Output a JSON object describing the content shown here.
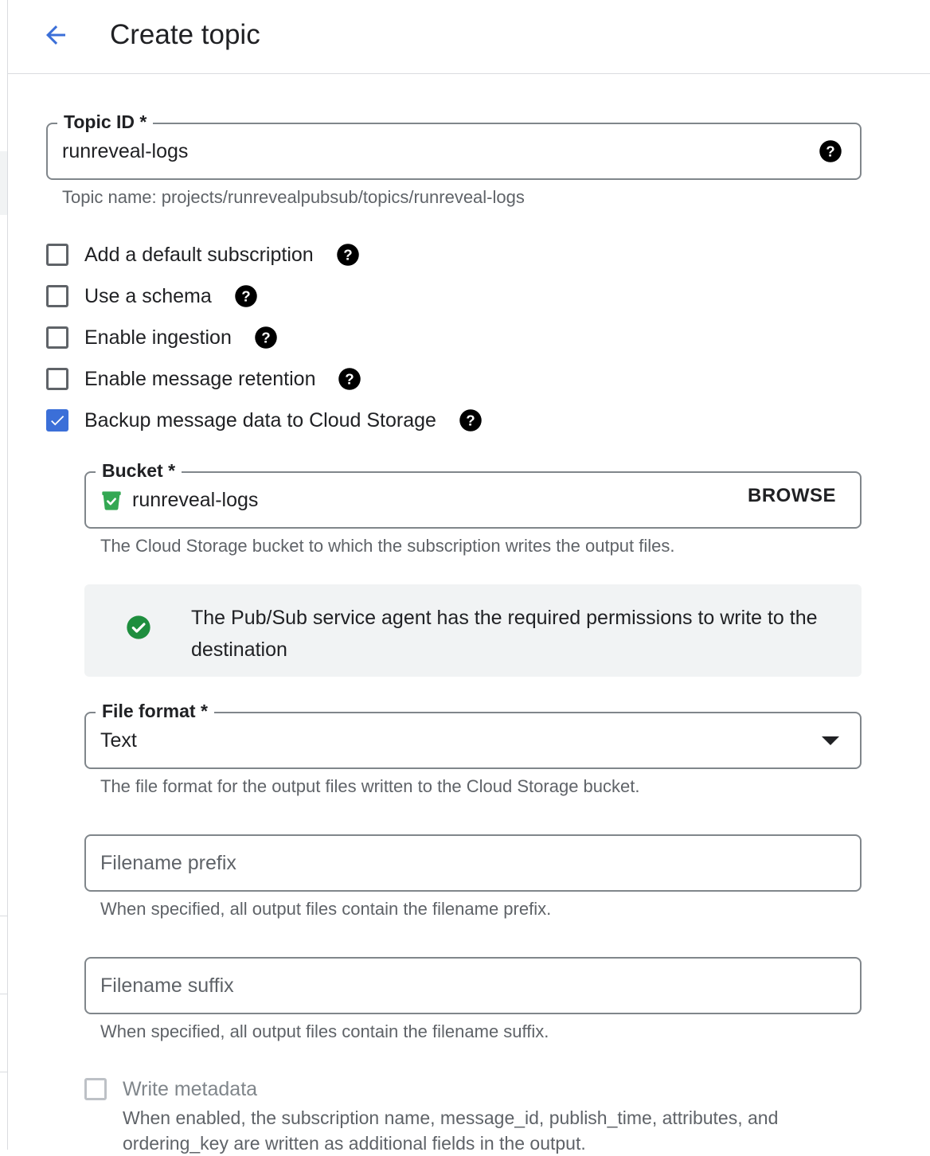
{
  "header": {
    "title": "Create topic"
  },
  "topic": {
    "label": "Topic ID *",
    "value": "runreveal-logs",
    "helper": "Topic name: projects/runrevealpubsub/topics/runreveal-logs"
  },
  "options": [
    {
      "label": "Add a default subscription",
      "checked": false
    },
    {
      "label": "Use a schema",
      "checked": false
    },
    {
      "label": "Enable ingestion",
      "checked": false
    },
    {
      "label": "Enable message retention",
      "checked": false
    },
    {
      "label": "Backup message data to Cloud Storage",
      "checked": true
    }
  ],
  "bucket": {
    "label": "Bucket *",
    "value": "runreveal-logs",
    "browse_label": "BROWSE",
    "helper": "The Cloud Storage bucket to which the subscription writes the output files."
  },
  "permission_notice": {
    "text": "The Pub/Sub service agent has the required permissions to write to the destination"
  },
  "file_format": {
    "label": "File format *",
    "value": "Text",
    "helper": "The file format for the output files written to the Cloud Storage bucket."
  },
  "filename_prefix": {
    "placeholder": "Filename prefix",
    "helper": "When specified, all output files contain the filename prefix."
  },
  "filename_suffix": {
    "placeholder": "Filename suffix",
    "helper": "When specified, all output files contain the filename suffix."
  },
  "write_metadata": {
    "label": "Write metadata",
    "checked": false,
    "disabled": true,
    "description": "When enabled, the subscription name, message_id, publish_time, attributes, and ordering_key are written as additional fields in the output."
  },
  "colors": {
    "accent": "#3b6fd8",
    "success": "#1e8e3e",
    "bucket_icon": "#34a853"
  }
}
